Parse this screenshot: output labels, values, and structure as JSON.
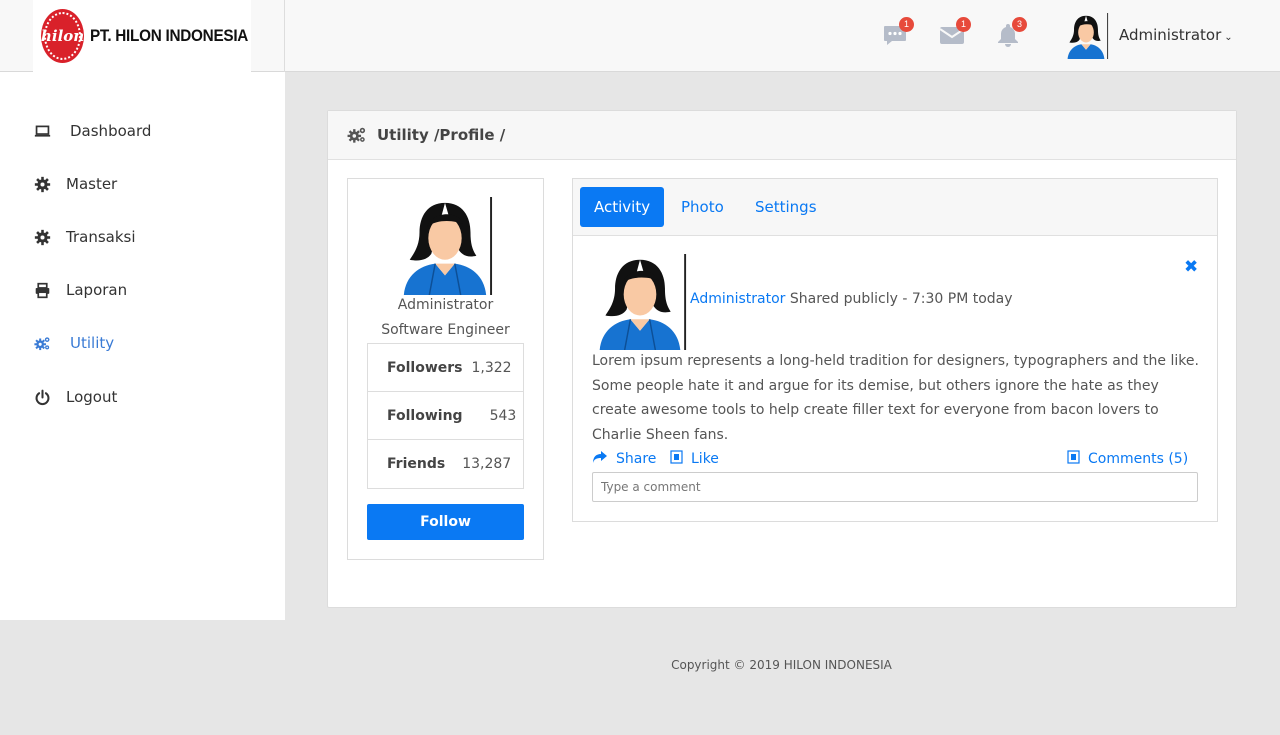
{
  "brand": {
    "logo_text": "hilon",
    "name": "PT. HILON INDONESIA"
  },
  "topbar": {
    "chat_badge": "1",
    "mail_badge": "1",
    "bell_badge": "3",
    "user_name": "Administrator",
    "caret": "⌄"
  },
  "sidebar": {
    "items": [
      {
        "label": "Dashboard",
        "icon": "laptop-icon"
      },
      {
        "label": "Master",
        "icon": "gear-icon"
      },
      {
        "label": "Transaksi",
        "icon": "gear-icon"
      },
      {
        "label": "Laporan",
        "icon": "printer-icon"
      },
      {
        "label": "Utility",
        "icon": "gears-icon"
      },
      {
        "label": "Logout",
        "icon": "power-icon"
      }
    ]
  },
  "breadcrumb": {
    "text": "Utility /Profile /"
  },
  "profile": {
    "name": "Administrator",
    "role": "Software Engineer",
    "stats": [
      {
        "label": "Followers",
        "value": "1,322"
      },
      {
        "label": "Following",
        "value": "543"
      },
      {
        "label": "Friends",
        "value": "13,287"
      }
    ],
    "follow_label": "Follow"
  },
  "tabs": [
    {
      "label": "Activity"
    },
    {
      "label": "Photo"
    },
    {
      "label": "Settings"
    }
  ],
  "post": {
    "author": "Administrator",
    "meta": "Shared publicly - 7:30 PM today",
    "close": "✖",
    "text": "Lorem ipsum represents a long-held tradition for designers, typographers and the like. Some people hate it and argue for its demise, but others ignore the hate as they create awesome tools to help create filler text for everyone from bacon lovers to Charlie Sheen fans.",
    "share_label": "Share",
    "like_label": "Like",
    "comments_label": "Comments (5)",
    "comment_placeholder": "Type a comment"
  },
  "footer": {
    "text": "Copyright © 2019 HILON INDONESIA"
  },
  "colors": {
    "accent": "#0a79f3",
    "badge": "#e74a3b",
    "brand_red": "#d9212a"
  }
}
